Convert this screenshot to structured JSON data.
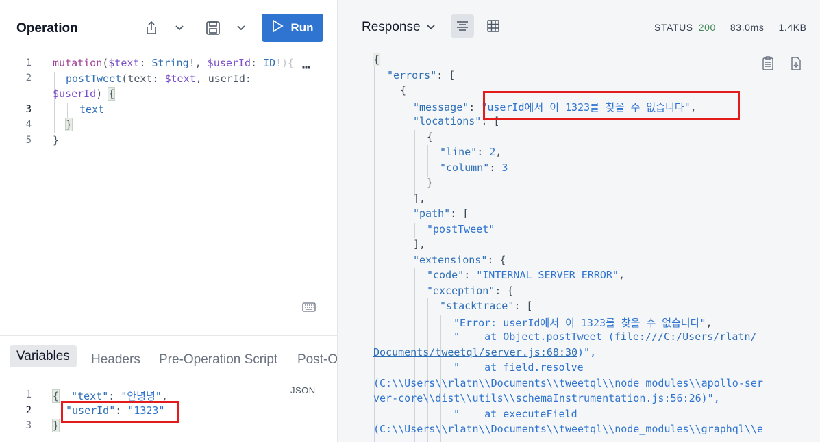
{
  "operation": {
    "title": "Operation",
    "run_label": "Run",
    "line_numbers": [
      "1",
      "2",
      "",
      "3",
      "4",
      "5"
    ],
    "lines": {
      "l1_kw": "mutation",
      "l1_paren": "(",
      "l1_var1": "$text",
      "l1_colon1": ": ",
      "l1_type1": "String",
      "l1_bang1": "!",
      "l1_comma": ", ",
      "l1_var2": "$userId",
      "l1_colon2": ": ",
      "l1_type2": "ID",
      "l1_rest": "!){",
      "l2_field": "postTweet",
      "l2_args": "(text: ",
      "l2_var": "$text",
      "l2_mid": ", userId:",
      "l2b_var": "$userId",
      "l2b_rest": ") ",
      "l2b_brace": "{",
      "l3_field": "text",
      "l4_brace": "}",
      "l5_brace": "}"
    }
  },
  "variables": {
    "tabs": [
      "Variables",
      "Headers",
      "Pre-Operation Script",
      "Post-Op"
    ],
    "format_label": "JSON",
    "line_numbers": [
      "1",
      "2",
      "3"
    ],
    "l1_open": "{",
    "l1_key": "\"text\"",
    "l1_colon": ": ",
    "l1_val": "\"안녕녕\"",
    "l1_comma": ",",
    "l2_key": "\"userId\"",
    "l2_colon": ": ",
    "l2_val": "\"1323\"",
    "l3_close": "}"
  },
  "response": {
    "title": "Response",
    "status_label": "STATUS",
    "status_code": "200",
    "time": "83.0ms",
    "size": "1.4KB",
    "lines": {
      "r1": "{",
      "r2_key": "\"errors\"",
      "r2_rest": ": [",
      "r3": "{",
      "r4_key": "\"message\"",
      "r4_colon": ": ",
      "r4_val": "\"userId에서 이 1323를 찾을 수 없습니다\"",
      "r4_comma": ",",
      "r5_key": "\"locations\"",
      "r5_rest": ": [",
      "r6": "{",
      "r7_key": "\"line\"",
      "r7_colon": ": ",
      "r7_val": "2",
      "r7_comma": ",",
      "r8_key": "\"column\"",
      "r8_colon": ": ",
      "r8_val": "3",
      "r9": "}",
      "r10": "],",
      "r11_key": "\"path\"",
      "r11_rest": ": [",
      "r12_val": "\"postTweet\"",
      "r13": "],",
      "r14_key": "\"extensions\"",
      "r14_rest": ": {",
      "r15_key": "\"code\"",
      "r15_colon": ": ",
      "r15_val": "\"INTERNAL_SERVER_ERROR\"",
      "r15_comma": ",",
      "r16_key": "\"exception\"",
      "r16_rest": ": {",
      "r17_key": "\"stacktrace\"",
      "r17_rest": ": [",
      "r18_val": "\"Error: userId에서 이 1323를 찾을 수 없습니다\"",
      "r18_comma": ",",
      "r19_val": "\"    at Object.postTweet (",
      "r19_link": "file:///C:/Users/rlatn/",
      "r20_link": "Documents/tweetql/server.js:68:30",
      "r20_rest": ")\",",
      "r21_val": "\"    at field.resolve",
      "r22_val": "(C:\\\\Users\\\\rlatn\\\\Documents\\\\tweetql\\\\node_modules\\\\apollo-ser",
      "r23_val": "ver-core\\\\dist\\\\utils\\\\schemaInstrumentation.js:56:26)\",",
      "r24_val": "\"    at executeField",
      "r25_val": "(C:\\\\Users\\\\rlatn\\\\Documents\\\\tweetql\\\\node_modules\\\\graphql\\\\e"
    }
  }
}
